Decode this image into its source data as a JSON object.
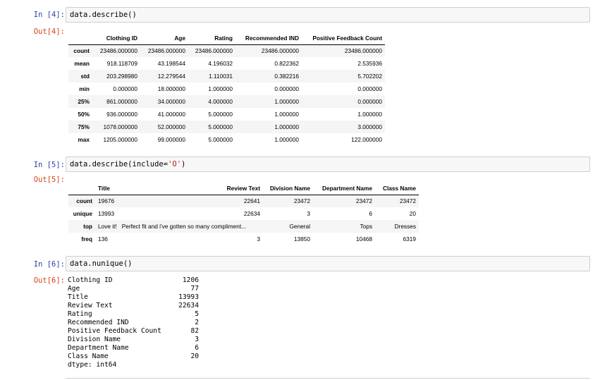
{
  "cells": {
    "c4": {
      "in_prompt": "In [4]:",
      "out_prompt": "Out[4]:",
      "code": "data.describe()",
      "table": {
        "columns": [
          "Clothing ID",
          "Age",
          "Rating",
          "Recommended IND",
          "Positive Feedback Count"
        ],
        "rows": [
          {
            "label": "count",
            "values": [
              "23486.000000",
              "23486.000000",
              "23486.000000",
              "23486.000000",
              "23486.000000"
            ]
          },
          {
            "label": "mean",
            "values": [
              "918.118709",
              "43.198544",
              "4.196032",
              "0.822362",
              "2.535936"
            ]
          },
          {
            "label": "std",
            "values": [
              "203.298980",
              "12.279544",
              "1.110031",
              "0.382216",
              "5.702202"
            ]
          },
          {
            "label": "min",
            "values": [
              "0.000000",
              "18.000000",
              "1.000000",
              "0.000000",
              "0.000000"
            ]
          },
          {
            "label": "25%",
            "values": [
              "861.000000",
              "34.000000",
              "4.000000",
              "1.000000",
              "0.000000"
            ]
          },
          {
            "label": "50%",
            "values": [
              "936.000000",
              "41.000000",
              "5.000000",
              "1.000000",
              "1.000000"
            ]
          },
          {
            "label": "75%",
            "values": [
              "1078.000000",
              "52.000000",
              "5.000000",
              "1.000000",
              "3.000000"
            ]
          },
          {
            "label": "max",
            "values": [
              "1205.000000",
              "99.000000",
              "5.000000",
              "1.000000",
              "122.000000"
            ]
          }
        ]
      }
    },
    "c5": {
      "in_prompt": "In [5]:",
      "out_prompt": "Out[5]:",
      "code_prefix": "data.describe(include=",
      "code_string": "'O'",
      "code_suffix": ")",
      "table": {
        "columns": [
          "Title",
          "Review Text",
          "Division Name",
          "Department Name",
          "Class Name"
        ],
        "rows": [
          {
            "label": "count",
            "values": [
              "19676",
              "22641",
              "23472",
              "23472",
              "23472"
            ]
          },
          {
            "label": "unique",
            "values": [
              "13993",
              "22634",
              "3",
              "6",
              "20"
            ]
          },
          {
            "label": "top",
            "values": [
              "Love it!",
              "Perfect fit and i've gotten so many compliment...",
              "General",
              "Tops",
              "Dresses"
            ]
          },
          {
            "label": "freq",
            "values": [
              "136",
              "3",
              "13850",
              "10468",
              "6319"
            ]
          }
        ]
      }
    },
    "c6": {
      "in_prompt": "In [6]:",
      "out_prompt": "Out[6]:",
      "code": "data.nunique()",
      "rows": [
        {
          "key": "Clothing ID",
          "value": "1206"
        },
        {
          "key": "Age",
          "value": "77"
        },
        {
          "key": "Title",
          "value": "13993"
        },
        {
          "key": "Review Text",
          "value": "22634"
        },
        {
          "key": "Rating",
          "value": "5"
        },
        {
          "key": "Recommended IND",
          "value": "2"
        },
        {
          "key": "Positive Feedback Count",
          "value": "82"
        },
        {
          "key": "Division Name",
          "value": "3"
        },
        {
          "key": "Department Name",
          "value": "6"
        },
        {
          "key": "Class Name",
          "value": "20"
        }
      ],
      "dtype": "dtype: int64"
    }
  },
  "colors": {
    "in_prompt": "#303f9f",
    "out_prompt": "#d84315",
    "input_bg": "#f7f7f7",
    "input_border": "#cfcfcf",
    "string_literal": "#ba2121"
  }
}
